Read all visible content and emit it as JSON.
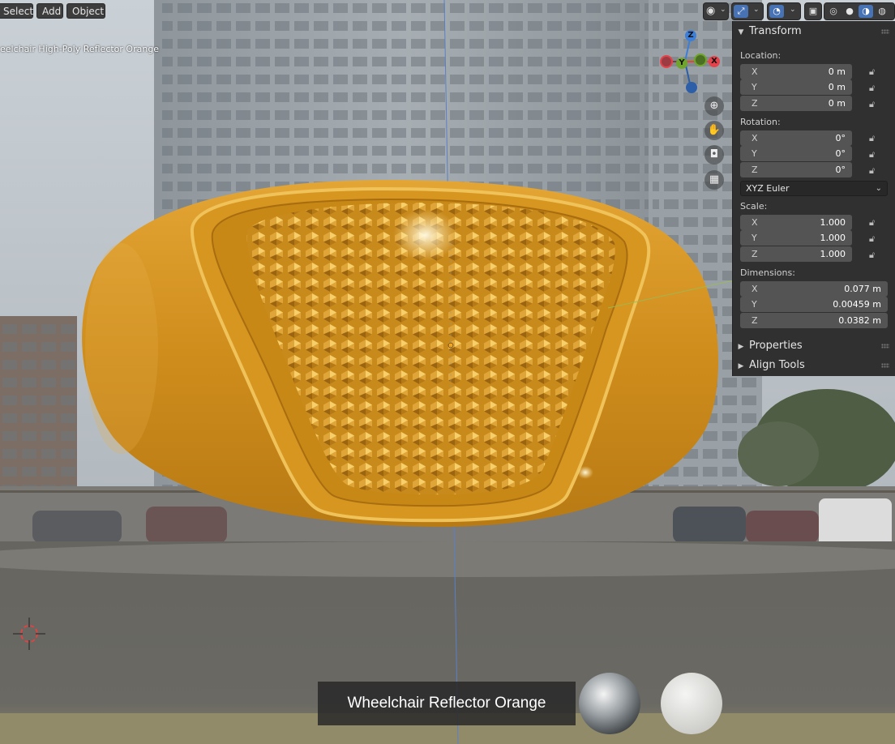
{
  "header": {
    "menu": [
      {
        "label": "Select"
      },
      {
        "label": "Add"
      },
      {
        "label": "Object"
      }
    ]
  },
  "viewport": {
    "object_label": "eelchair High-Poly Reflector Orange",
    "material_title": "Wheelchair Reflector Orange"
  },
  "gizmo": {
    "z": "Z",
    "y": "Y",
    "x": "X"
  },
  "npanel": {
    "transform": {
      "title": "Transform",
      "location_label": "Location:",
      "location": [
        {
          "axis": "X",
          "value": "0 m"
        },
        {
          "axis": "Y",
          "value": "0 m"
        },
        {
          "axis": "Z",
          "value": "0 m"
        }
      ],
      "rotation_label": "Rotation:",
      "rotation": [
        {
          "axis": "X",
          "value": "0°"
        },
        {
          "axis": "Y",
          "value": "0°"
        },
        {
          "axis": "Z",
          "value": "0°"
        }
      ],
      "rotation_mode": "XYZ Euler",
      "scale_label": "Scale:",
      "scale": [
        {
          "axis": "X",
          "value": "1.000"
        },
        {
          "axis": "Y",
          "value": "1.000"
        },
        {
          "axis": "Z",
          "value": "1.000"
        }
      ],
      "dimensions_label": "Dimensions:",
      "dimensions": [
        {
          "axis": "X",
          "value": "0.077 m"
        },
        {
          "axis": "Y",
          "value": "0.00459 m"
        },
        {
          "axis": "Z",
          "value": "0.0382 m"
        }
      ]
    },
    "properties_title": "Properties",
    "align_tools_title": "Align Tools"
  },
  "colors": {
    "panel_bg": "#303030",
    "field_bg": "#545454",
    "accent": "#4772b3",
    "reflector": "#d4901f",
    "axis_x": "#e5434c",
    "axis_y": "#6fa52c",
    "axis_z": "#3d7ed8"
  }
}
